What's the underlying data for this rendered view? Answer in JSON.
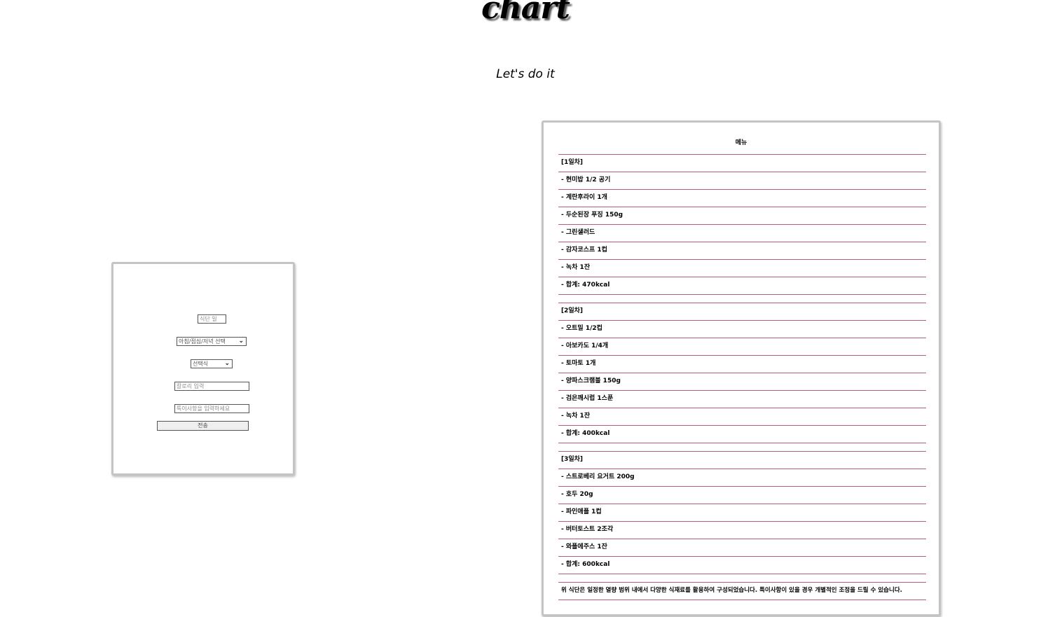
{
  "header": {
    "title": "chart",
    "subtitle": "Let's do it"
  },
  "form": {
    "date_placeholder": "식단 일",
    "meal_select": "아침/점심/저녁 선택",
    "food_select": "선택식",
    "calorie_placeholder": "칼로리 입력",
    "notes_placeholder": "특이사항을 입력하세요",
    "submit_label": "전송"
  },
  "menu": {
    "title": "메뉴",
    "day1": {
      "label": "[1일차]",
      "items": [
        "- 현미밥 1/2 공기",
        "- 계란후라이 1개",
        "- 두순된장 푸징 150g",
        "- 그린샐러드",
        "- 감자코스프 1컵",
        "- 녹차 1잔",
        "- 합계: 470kcal"
      ]
    },
    "day2": {
      "label": "[2일차]",
      "items": [
        "- 오트밀 1/2컵",
        "- 아보카도 1/4개",
        "- 토마토 1개",
        "- 양파스크램블 150g",
        "- 검은깨시럽 1스푼",
        "- 녹차 1잔",
        "- 합계: 400kcal"
      ]
    },
    "day3": {
      "label": "[3일차]",
      "items": [
        "- 스트로베리 요거트 200g",
        "- 호두 20g",
        "- 파인애플 1컵",
        "- 버터토스트 2조각",
        "- 와플에주스 1잔",
        "- 합계: 600kcal"
      ]
    },
    "note": "위 식단은 일정한 열량 범위 내에서 다양한 식재료를 활용하여 구성되었습니다. 특이사항이 있을 경우 개별적인 조정을 드릴 수 있습니다."
  }
}
